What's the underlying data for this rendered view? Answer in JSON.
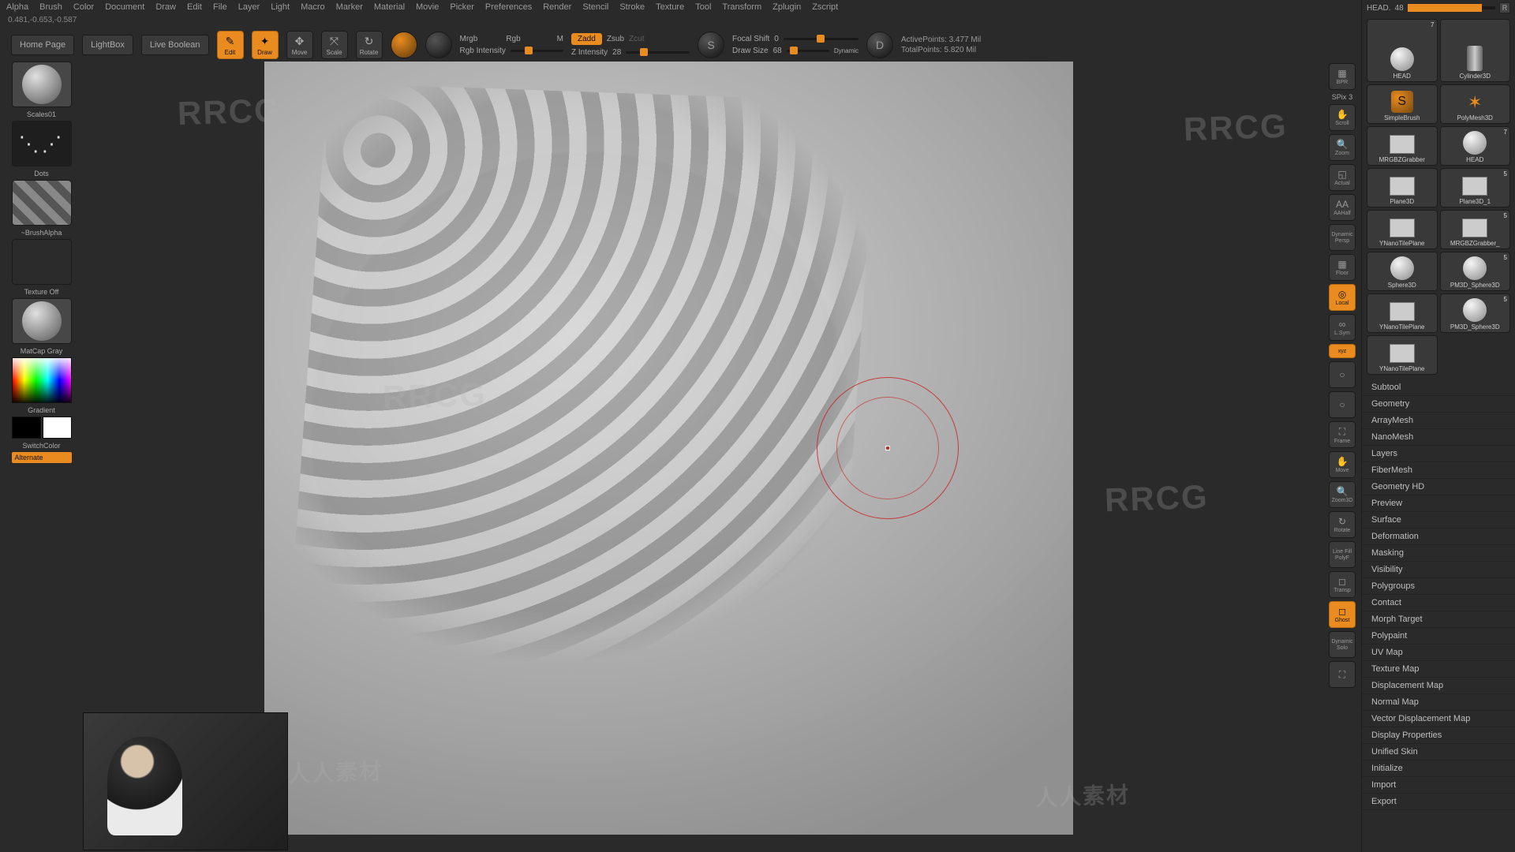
{
  "menu": [
    "Alpha",
    "Brush",
    "Color",
    "Document",
    "Draw",
    "Edit",
    "File",
    "Layer",
    "Light",
    "Macro",
    "Marker",
    "Material",
    "Movie",
    "Picker",
    "Preferences",
    "Render",
    "Stencil",
    "Stroke",
    "Texture",
    "Tool",
    "Transform",
    "Zplugin",
    "Zscript"
  ],
  "status_coords": "0.481,-0.653,-0.587",
  "topbar": {
    "home": "Home Page",
    "lightbox": "LightBox",
    "liveboolean": "Live Boolean",
    "edit": "Edit",
    "draw": "Draw",
    "move": "Move",
    "scale": "Scale",
    "rotate": "Rotate",
    "mrgb": "Mrgb",
    "rgb": "Rgb",
    "m": "M",
    "rgb_intensity_label": "Rgb Intensity",
    "zadd": "Zadd",
    "zsub": "Zsub",
    "zcut": "Zcut",
    "z_intensity_label": "Z Intensity",
    "z_intensity_val": "28",
    "focal_shift_label": "Focal Shift",
    "focal_shift_val": "0",
    "draw_size_label": "Draw Size",
    "draw_size_val": "68",
    "dynamic": "Dynamic",
    "active_points": "ActivePoints: 3.477 Mil",
    "total_points": "TotalPoints: 5.820 Mil"
  },
  "left": {
    "brush": "Scales01",
    "stroke": "Dots",
    "alpha": "~BrushAlpha",
    "texture": "Texture Off",
    "material": "MatCap Gray",
    "gradient": "Gradient",
    "switchcolor": "SwitchColor",
    "alternate": "Alternate"
  },
  "rtstrip": {
    "bpr": "BPR",
    "spix": "SPix",
    "spix_val": "3",
    "scroll": "Scroll",
    "zoom": "Zoom",
    "actual": "Actual",
    "aahalf": "AAHalf",
    "dynamic": "Dynamic",
    "persp": "Persp",
    "floor": "Floor",
    "local": "Local",
    "lsym": "L.Sym",
    "xyz": "xyz",
    "frame": "Frame",
    "move": "Move",
    "zoom3d": "Zoom3D",
    "rotate": "Rotate",
    "linefill": "Line Fill",
    "polyf": "PolyF",
    "transp": "Transp",
    "ghost": "Ghost",
    "dynamic2": "Dynamic",
    "solo": "Solo"
  },
  "tool_header": {
    "name": "HEAD.",
    "val": "48",
    "r": "R"
  },
  "tools": [
    {
      "name": "HEAD",
      "count": "7",
      "type": "sphere",
      "big": true
    },
    {
      "name": "Cylinder3D",
      "count": "",
      "type": "cyl",
      "big": true
    },
    {
      "name": "SimpleBrush",
      "count": "",
      "type": "brush"
    },
    {
      "name": "PolyMesh3D",
      "count": "",
      "type": "star"
    },
    {
      "name": "MRGBZGrabber",
      "count": "",
      "type": "plane"
    },
    {
      "name": "HEAD",
      "count": "7",
      "type": "sphere"
    },
    {
      "name": "Plane3D",
      "count": "",
      "type": "plane"
    },
    {
      "name": "Plane3D_1",
      "count": "5",
      "type": "plane"
    },
    {
      "name": "YNanoTilePlane",
      "count": "",
      "type": "plane"
    },
    {
      "name": "MRGBZGrabber_",
      "count": "5",
      "type": "plane"
    },
    {
      "name": "Sphere3D",
      "count": "",
      "type": "sphere"
    },
    {
      "name": "PM3D_Sphere3D",
      "count": "5",
      "type": "sphere"
    },
    {
      "name": "YNanoTilePlane",
      "count": "",
      "type": "plane"
    },
    {
      "name": "PM3D_Sphere3D",
      "count": "5",
      "type": "sphere"
    },
    {
      "name": "YNanoTilePlane",
      "count": "",
      "type": "plane"
    }
  ],
  "accordion": [
    "Subtool",
    "Geometry",
    "ArrayMesh",
    "NanoMesh",
    "Layers",
    "FiberMesh",
    "Geometry HD",
    "Preview",
    "Surface",
    "Deformation",
    "Masking",
    "Visibility",
    "Polygroups",
    "Contact",
    "Morph Target",
    "Polypaint",
    "UV Map",
    "Texture Map",
    "Displacement Map",
    "Normal Map",
    "Vector Displacement Map",
    "Display Properties",
    "Unified Skin",
    "Initialize",
    "Import",
    "Export"
  ],
  "watermark_text": "RRCG",
  "watermark_cn": "人人素材"
}
